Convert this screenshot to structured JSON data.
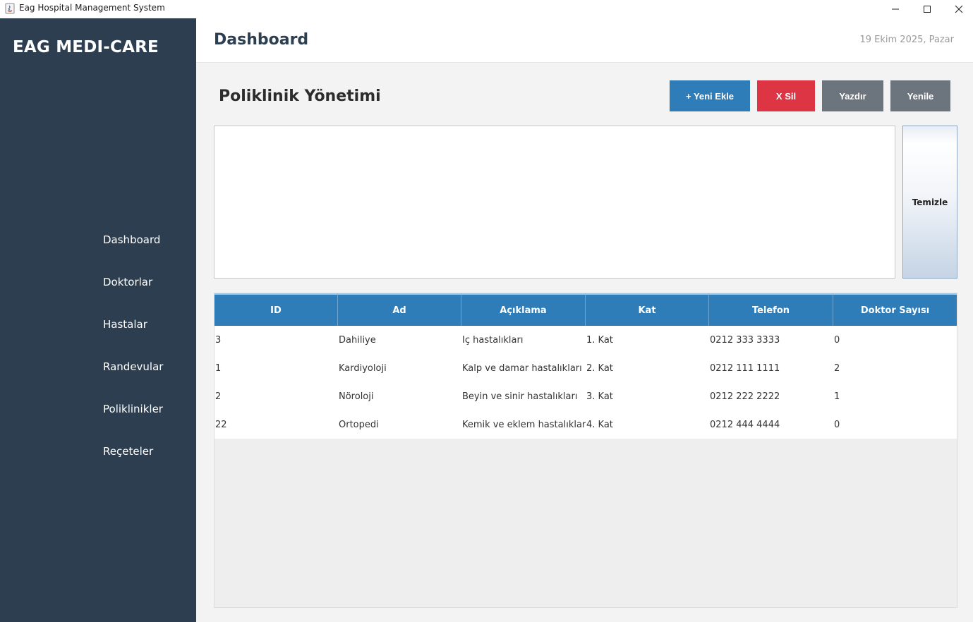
{
  "window": {
    "title": "Eag Hospital Management System"
  },
  "sidebar": {
    "brand": "EAG MEDI-CARE",
    "items": [
      {
        "label": "Dashboard"
      },
      {
        "label": "Doktorlar"
      },
      {
        "label": "Hastalar"
      },
      {
        "label": "Randevular"
      },
      {
        "label": "Poliklinikler"
      },
      {
        "label": "Reçeteler"
      }
    ]
  },
  "header": {
    "title": "Dashboard",
    "date": "19 Ekim 2025, Pazar"
  },
  "section": {
    "title": "Poliklinik Yönetimi",
    "buttons": {
      "add": "+ Yeni Ekle",
      "delete": "X Sil",
      "print": "Yazdır",
      "refresh": "Yenile"
    },
    "clear_button": "Temizle"
  },
  "table": {
    "columns": [
      "ID",
      "Ad",
      "Açıklama",
      "Kat",
      "Telefon",
      "Doktor Sayısı"
    ],
    "rows": [
      [
        "3",
        "Dahiliye",
        "İç hastalıkları",
        "1. Kat",
        "0212 333 3333",
        "0"
      ],
      [
        "1",
        "Kardiyoloji",
        "Kalp ve damar hastalıkları",
        "2. Kat",
        "0212 111 1111",
        "2"
      ],
      [
        "2",
        "Nöroloji",
        "Beyin ve sinir hastalıkları",
        "3. Kat",
        "0212 222 2222",
        "1"
      ],
      [
        "22",
        "Ortopedi",
        "Kemik ve eklem hastalıkları",
        "4. Kat",
        "0212 444 4444",
        "0"
      ]
    ]
  },
  "colors": {
    "sidebar": "#2c3e50",
    "primary": "#2e7db8",
    "danger": "#de3545",
    "secondary": "#6c757d"
  },
  "icons": {
    "app": "java-app-icon",
    "minimize": "minimize-icon",
    "maximize": "maximize-icon",
    "close": "close-icon"
  }
}
